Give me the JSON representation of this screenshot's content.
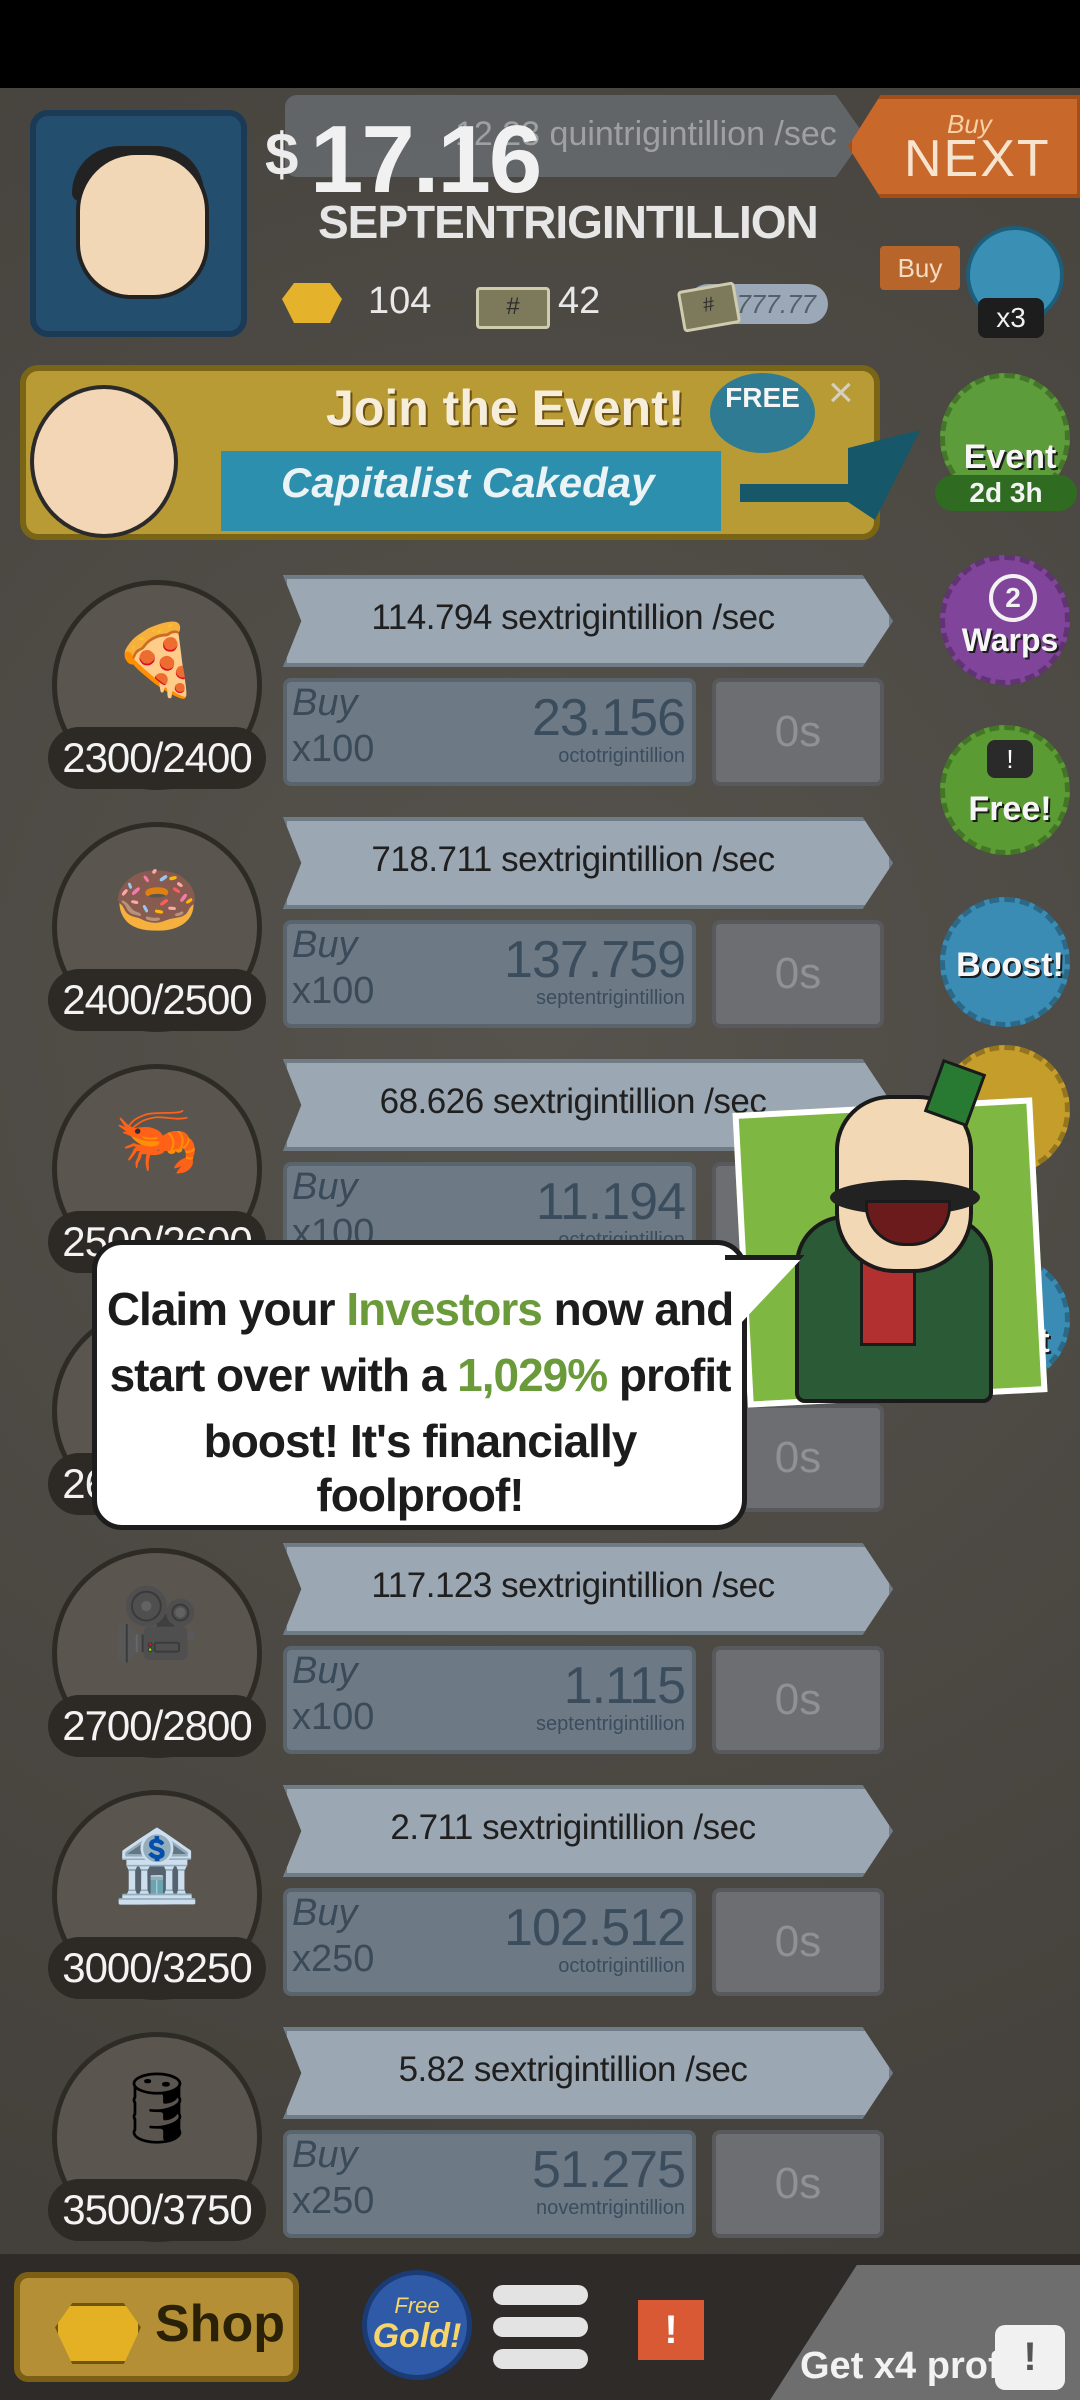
{
  "header": {
    "money_symbol": "$",
    "money_value": "17.16",
    "money_unit": "SEPTENTRIGINTILLION",
    "income_hint": "12.23 quintrigintillion /sec",
    "gold": "104",
    "tickets": "42",
    "mega_multiplier": "x777.77",
    "buy_next_small": "Buy",
    "buy_next_label": "NEXT",
    "buy_tag": "Buy",
    "camera_multiplier": "x3"
  },
  "event_banner": {
    "title": "Join the Event!",
    "subtitle": "Capitalist Cakeday",
    "free_label": "FREE",
    "close_symbol": "×"
  },
  "side_buttons": {
    "event_label": "Event",
    "event_timer": "2d 3h",
    "warps_count": "2",
    "warps_label": "Warps",
    "free_label": "Free!",
    "free_tv_symbol": "!",
    "boost_label": "Boost!",
    "project_label": "ect"
  },
  "businesses": [
    {
      "icon": "🍕",
      "count": "2300/2400",
      "income": "114.794 sextrigintillion /sec",
      "buy_word": "Buy",
      "buy_mult": "x100",
      "cost": "23.156",
      "cost_unit": "octotrigintillion",
      "timer": "0s"
    },
    {
      "icon": "🍩",
      "count": "2400/2500",
      "income": "718.711 sextrigintillion /sec",
      "buy_word": "Buy",
      "buy_mult": "x100",
      "cost": "137.759",
      "cost_unit": "septentrigintillion",
      "timer": "0s"
    },
    {
      "icon": "🦐",
      "count": "2500/2600",
      "income": "68.626 sextrigintillion /sec",
      "buy_word": "Buy",
      "buy_mult": "x100",
      "cost": "11.194",
      "cost_unit": "octotrigintillion",
      "timer": "0s"
    },
    {
      "icon": "⚽",
      "count": "2600/2700",
      "income": "",
      "buy_word": "",
      "buy_mult": "",
      "cost": "",
      "cost_unit": "",
      "timer": "0s"
    },
    {
      "icon": "🎥",
      "count": "2700/2800",
      "income": "117.123 sextrigintillion /sec",
      "buy_word": "Buy",
      "buy_mult": "x100",
      "cost": "1.115",
      "cost_unit": "septentrigintillion",
      "timer": "0s"
    },
    {
      "icon": "🏦",
      "count": "3000/3250",
      "income": "2.711 sextrigintillion /sec",
      "buy_word": "Buy",
      "buy_mult": "x250",
      "cost": "102.512",
      "cost_unit": "octotrigintillion",
      "timer": "0s"
    },
    {
      "icon": "🛢",
      "count": "3500/3750",
      "income": "5.82 sextrigintillion /sec",
      "buy_word": "Buy",
      "buy_mult": "x250",
      "cost": "51.275",
      "cost_unit": "novemtrigintillion",
      "timer": "0s"
    }
  ],
  "popup": {
    "line1_a": "Claim your ",
    "line1_b": "Investors",
    "line1_c": " now and",
    "line2_a": "start over with a ",
    "line2_b": "1,029%",
    "line2_c": " profit",
    "line3": "boost! It's financially foolproof!"
  },
  "footer": {
    "shop_label": "Shop",
    "free_gold_1": "Free",
    "free_gold_2": "Gold!",
    "alert_symbol": "!",
    "get_profit": "Get x4 profit!",
    "tv_symbol": "!"
  },
  "colors": {
    "background": "#4d4943",
    "income_bar": "#9ba7b2",
    "buy_box": "#6d7a86",
    "accent_green": "#6a9a3a"
  }
}
